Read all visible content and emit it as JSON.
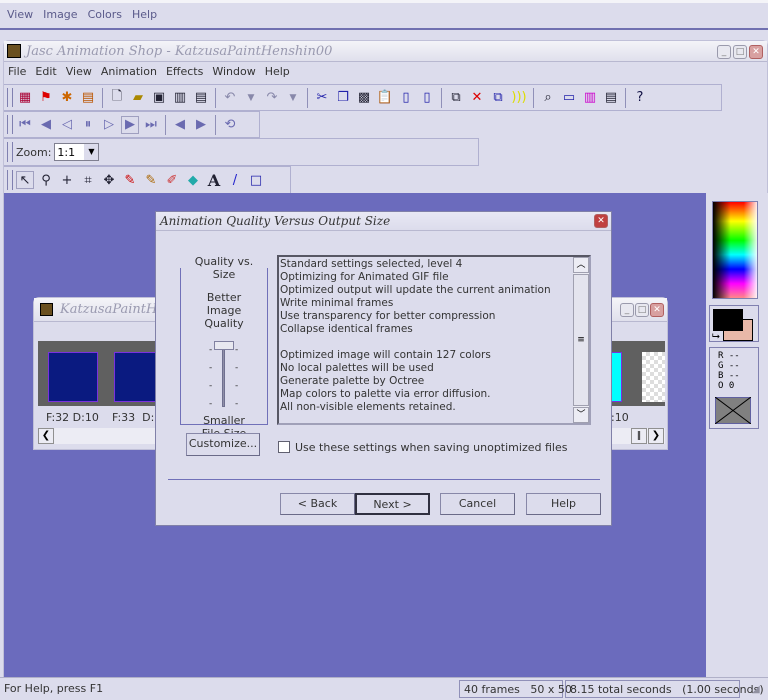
{
  "background_app": {
    "menu": [
      "View",
      "Image",
      "Colors",
      "Help"
    ]
  },
  "window": {
    "title": "Jasc Animation Shop - KatzusaPaintHenshin00",
    "menu": [
      "File",
      "Edit",
      "View",
      "Animation",
      "Effects",
      "Window",
      "Help"
    ]
  },
  "toolbar_main": {
    "icons": [
      "animation-wizard-icon",
      "banner-wizard-icon",
      "optimization-wizard-icon",
      "palette-icon",
      "new-icon",
      "open-icon",
      "save-icon",
      "save-as-icon",
      "print-icon",
      "undo-icon",
      "undo-dropdown-icon",
      "redo-icon",
      "redo-dropdown-icon",
      "cut-icon",
      "copy-icon",
      "copy-frames-icon",
      "paste-icon",
      "paste-before-icon",
      "paste-after-icon",
      "insert-frames-icon",
      "delete-frames-icon",
      "duplicate-frames-icon",
      "effect-icon",
      "zoom-view-icon",
      "frame-properties-icon",
      "color-palette-icon",
      "film-strip-icon",
      "context-help-icon"
    ]
  },
  "toolbar_vcr": {
    "icons": [
      "first-frame-icon",
      "previous-frame-icon",
      "step-back-icon",
      "pause-icon",
      "step-forward-icon",
      "play-icon",
      "last-frame-icon",
      "previous-icon",
      "next-icon",
      "loop-icon"
    ]
  },
  "zoom_bar": {
    "label": "Zoom:",
    "value": "1:1"
  },
  "tools": {
    "icons": [
      "arrow-tool-icon",
      "zoom-tool-icon",
      "crosshair-tool-icon",
      "crop-tool-icon",
      "mover-tool-icon",
      "dropper-tool-icon",
      "brush-tool-icon",
      "eraser-tool-icon",
      "fill-tool-icon",
      "text-tool-icon",
      "line-tool-icon",
      "rectangle-tool-icon"
    ]
  },
  "anim_window": {
    "title": "KatzusaPaintHenshin00",
    "frames": [
      {
        "label": "F:32  D:10"
      },
      {
        "label": "F:33  D:"
      }
    ],
    "right_label": ":10"
  },
  "dialog": {
    "title": "Animation Quality Versus Output Size",
    "group_label": "Quality vs. Size",
    "top_label": "Better Image Quality",
    "bottom_label": "Smaller File Size",
    "slider_level": 4,
    "info_lines": [
      "Standard settings selected, level 4",
      "Optimizing for Animated GIF file",
      "Optimized output will update the current animation",
      "Write minimal frames",
      "Use transparency for better compression",
      "Collapse identical frames",
      "",
      "Optimized image will contain 127 colors",
      "No local palettes will be used",
      "Generate palette by Octree",
      "Map colors to palette via error diffusion.",
      "All non-visible elements retained."
    ],
    "customize": "Customize...",
    "checkbox_label": "Use these settings when saving unoptimized files",
    "checkbox_checked": false,
    "buttons": {
      "back": "< Back",
      "next": "Next >",
      "cancel": "Cancel",
      "help": "Help"
    }
  },
  "palette_panel": {
    "foreground": "#000000",
    "background": "#e8b8a8",
    "r": "R --",
    "g": "G --",
    "b": "B --",
    "o": "O 0"
  },
  "status": {
    "help": "For Help, press F1",
    "frames": "40 frames   50 x 50",
    "seconds": "8.15 total seconds   (1.00 seconds)"
  },
  "colors": {
    "workspace": "#6b6bbd",
    "chrome": "#dcdcec"
  }
}
